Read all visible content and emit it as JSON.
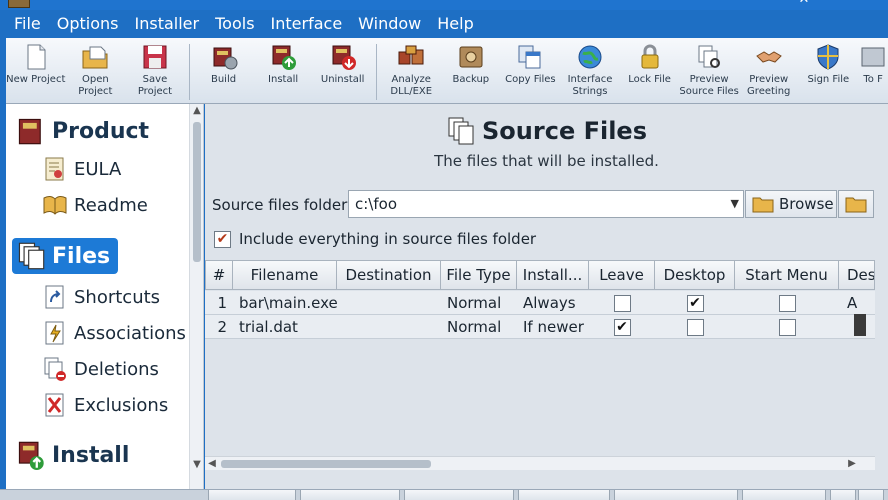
{
  "menu": [
    "File",
    "Options",
    "Installer",
    "Tools",
    "Interface",
    "Window",
    "Help"
  ],
  "toolbar": [
    {
      "label": "New Project",
      "icon": "new-project-icon"
    },
    {
      "label": "Open Project",
      "icon": "open-project-icon"
    },
    {
      "label": "Save Project",
      "icon": "save-project-icon"
    },
    {
      "label": "Build",
      "icon": "build-icon"
    },
    {
      "label": "Install",
      "icon": "install-icon"
    },
    {
      "label": "Uninstall",
      "icon": "uninstall-icon"
    },
    {
      "label": "Analyze DLL/EXE",
      "icon": "analyze-icon"
    },
    {
      "label": "Backup",
      "icon": "backup-icon"
    },
    {
      "label": "Copy Files",
      "icon": "copy-files-icon"
    },
    {
      "label": "Interface Strings",
      "icon": "globe-icon"
    },
    {
      "label": "Lock File",
      "icon": "lock-icon"
    },
    {
      "label": "Preview Source Files",
      "icon": "preview-files-icon"
    },
    {
      "label": "Preview Greeting",
      "icon": "handshake-icon"
    },
    {
      "label": "Sign File",
      "icon": "shield-icon"
    },
    {
      "label": "To F",
      "icon": "tool-icon"
    }
  ],
  "sidebar": {
    "product": "Product",
    "eula": "EULA",
    "readme": "Readme",
    "files": "Files",
    "shortcuts": "Shortcuts",
    "associations": "Associations",
    "deletions": "Deletions",
    "exclusions": "Exclusions",
    "install": "Install"
  },
  "page": {
    "title": "Source Files",
    "subtitle": "The files that will be installed.",
    "folder_label": "Source files folder:",
    "folder_value": "c:\\foo",
    "browse_label": "Browse",
    "include_label": "Include everything in source files folder",
    "include_checked": "✔"
  },
  "grid": {
    "headers": [
      "#",
      "Filename",
      "Destination",
      "File Type",
      "Install...",
      "Leave",
      "Desktop",
      "Start Menu",
      "Des"
    ],
    "rows": [
      {
        "num": "1",
        "filename": "bar\\main.exe",
        "destination": "",
        "filetype": "Normal",
        "install": "Always",
        "leave": "",
        "desktop": "✔",
        "startmenu": "",
        "des": "A"
      },
      {
        "num": "2",
        "filename": "trial.dat",
        "destination": "",
        "filetype": "Normal",
        "install": "If newer",
        "leave": "✔",
        "desktop": "",
        "startmenu": "",
        "des": ""
      }
    ]
  },
  "colors": {
    "menubar": "#1e6fc4",
    "selected": "#1d7ad6",
    "panel": "#dde3ea"
  }
}
